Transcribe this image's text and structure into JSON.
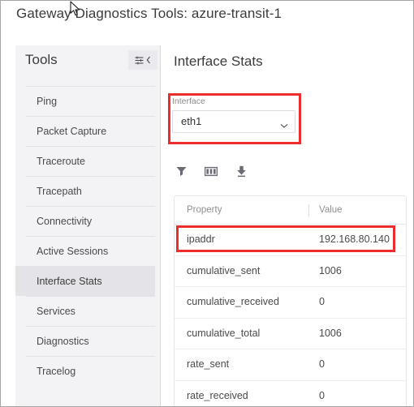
{
  "page": {
    "title": "Gateway Diagnostics Tools: azure-transit-1"
  },
  "sidebar": {
    "title": "Tools",
    "header_button": {
      "name": "sliders-collapse",
      "icon_sliders": "sliders-icon",
      "icon_chevron": "chevron-left-icon"
    },
    "items": [
      {
        "label": "Ping",
        "selected": false
      },
      {
        "label": "Packet Capture",
        "selected": false
      },
      {
        "label": "Traceroute",
        "selected": false
      },
      {
        "label": "Tracepath",
        "selected": false
      },
      {
        "label": "Connectivity",
        "selected": false
      },
      {
        "label": "Active Sessions",
        "selected": false
      },
      {
        "label": "Interface Stats",
        "selected": true
      },
      {
        "label": "Services",
        "selected": false
      },
      {
        "label": "Diagnostics",
        "selected": false
      },
      {
        "label": "Tracelog",
        "selected": false
      }
    ]
  },
  "content": {
    "title": "Interface Stats",
    "interface_field": {
      "label": "Interface",
      "value": "eth1",
      "caret_icon": "chevron-down-icon"
    },
    "toolbar": [
      {
        "name": "filter-icon",
        "label": "Filter"
      },
      {
        "name": "columns-icon",
        "label": "Columns"
      },
      {
        "name": "download-icon",
        "label": "Download"
      }
    ],
    "table": {
      "columns": [
        "Property",
        "Value"
      ],
      "rows": [
        {
          "property": "ipaddr",
          "value": "192.168.80.140",
          "highlighted": true
        },
        {
          "property": "cumulative_sent",
          "value": "1006",
          "highlighted": false
        },
        {
          "property": "cumulative_received",
          "value": "0",
          "highlighted": false
        },
        {
          "property": "cumulative_total",
          "value": "1006",
          "highlighted": false
        },
        {
          "property": "rate_sent",
          "value": "0",
          "highlighted": false
        },
        {
          "property": "rate_received",
          "value": "0",
          "highlighted": false
        }
      ]
    }
  },
  "annotations": {
    "color": "#ec2d2d",
    "boxes": [
      {
        "name": "interface-selector-highlight"
      },
      {
        "name": "ipaddr-row-highlight"
      }
    ]
  },
  "cursor": {
    "name": "mouse-pointer"
  }
}
